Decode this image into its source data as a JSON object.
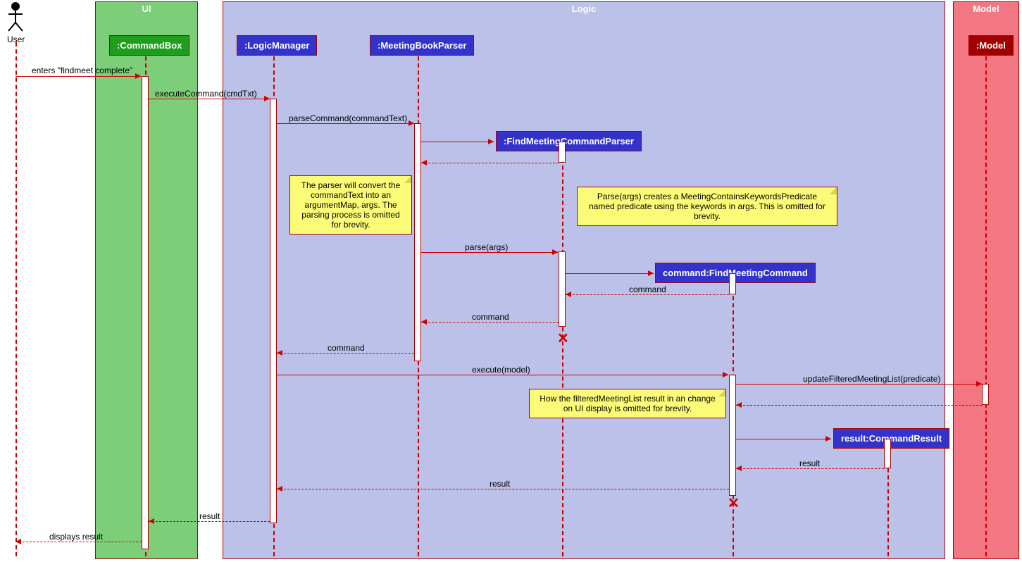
{
  "actor_label": "User",
  "frames": {
    "ui": "UI",
    "logic": "Logic",
    "model": "Model"
  },
  "participants": {
    "commandBox": ":CommandBox",
    "logicManager": ":LogicManager",
    "meetingBookParser": ":MeetingBookParser",
    "findMeetingCommandParser": ":FindMeetingCommandParser",
    "findMeetingCommand": "command:FindMeetingCommand",
    "model": ":Model",
    "commandResult": "result:CommandResult"
  },
  "messages": {
    "m1": "enters \"findmeet complete\"",
    "m2": "executeCommand(cmdTxt)",
    "m3": "parseCommand(commandText)",
    "m4": "parse(args)",
    "m5": "command",
    "m6": "command",
    "m7": "command",
    "m8": "execute(model)",
    "m9": "updateFilteredMeetingList(predicate)",
    "m10": "result",
    "m11": "result",
    "m12": "result",
    "m13": "displays result"
  },
  "notes": {
    "n1": "The parser will convert the commandText into an argumentMap, args. The parsing process is omitted for brevity.",
    "n2": "Parse(args) creates a MeetingContainsKeywordsPredicate named predicate using the keywords in args. This is omitted for brevity.",
    "n3": "How the filteredMeetingList result in an change on UI display is omitted for brevity."
  }
}
